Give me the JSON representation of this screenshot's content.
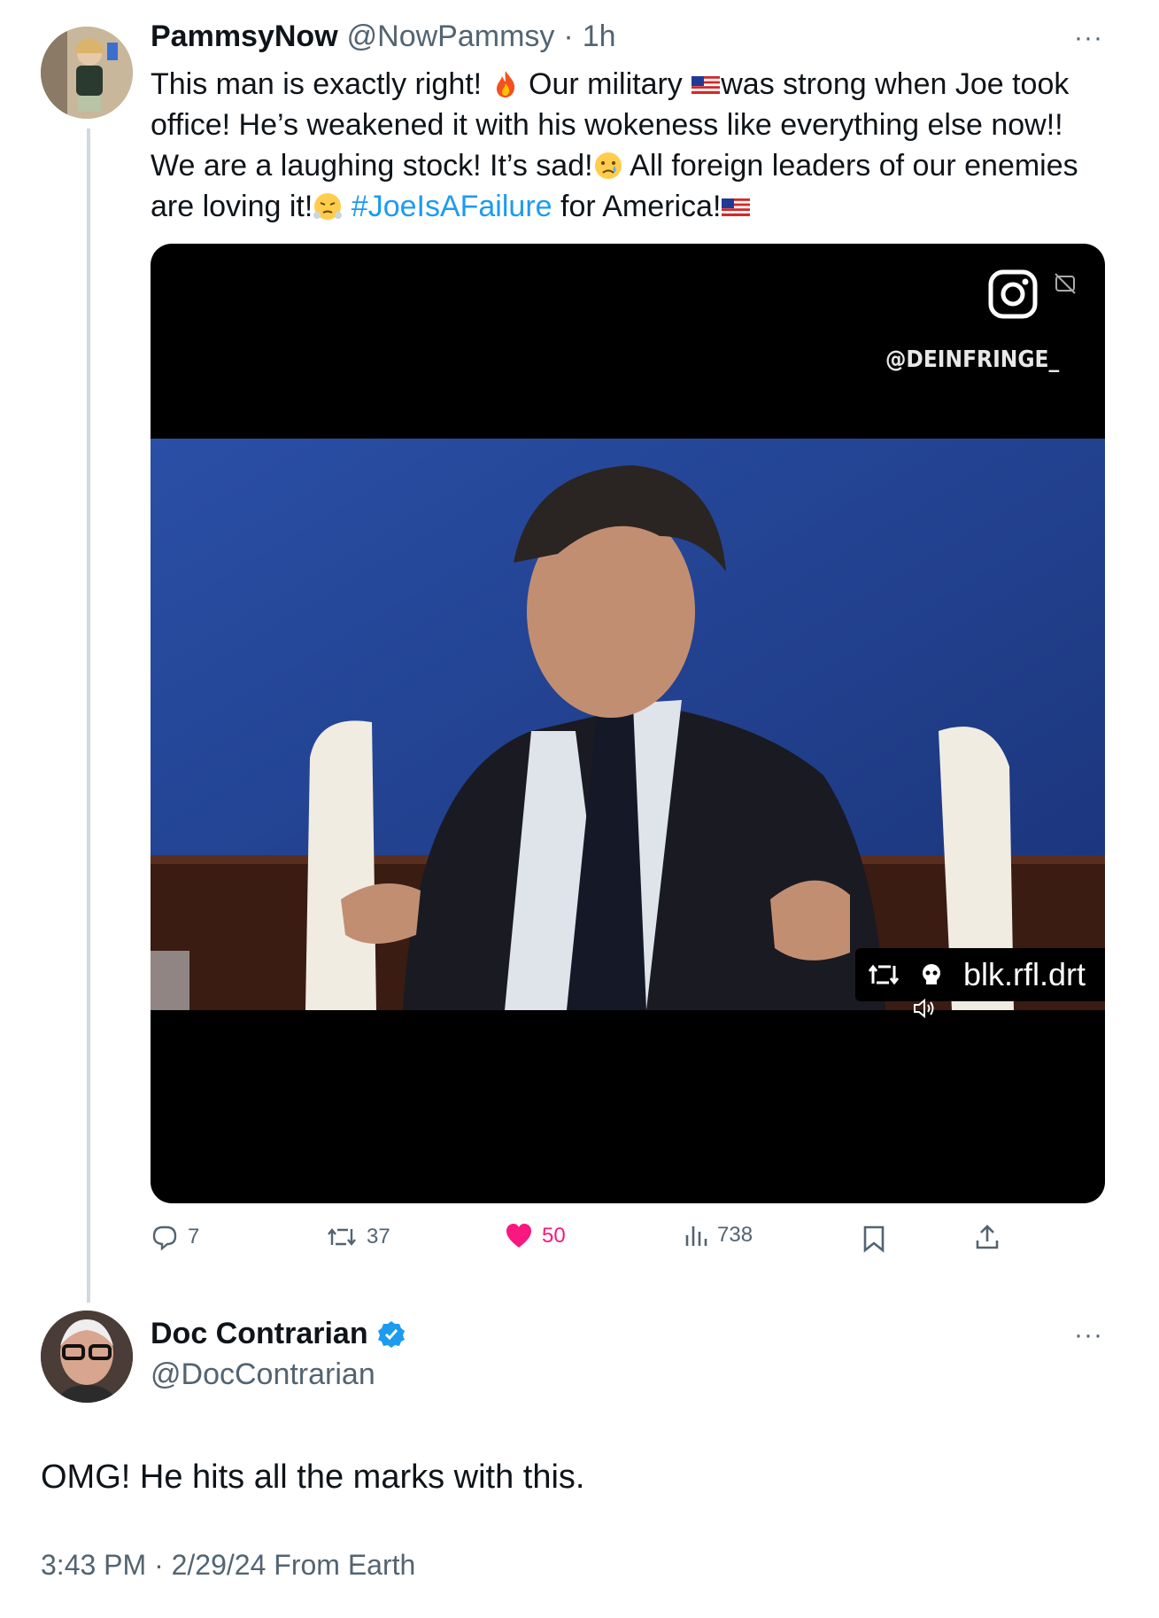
{
  "tweet1": {
    "display_name": "PammsyNow",
    "handle": "@NowPammsy",
    "separator": "·",
    "time": "1h",
    "more": "···",
    "text_1": "This man is exactly right! ",
    "text_2": " Our military ",
    "text_3": "was strong when Joe took office! He’s weakened it with his wokeness like everything else now!! We are a laughing stock! It’s sad!",
    "text_4": " All foreign leaders of our enemies are loving it!",
    "hashtag": "#JoeIsAFailure",
    "text_5": " for America!",
    "video": {
      "overlay_handle": "@DEINFRINGE_",
      "watermark_text": "blk.rfl.drt"
    },
    "actions": {
      "replies": "7",
      "reposts": "37",
      "likes": "50",
      "views": "738"
    }
  },
  "tweet2": {
    "display_name": "Doc Contrarian",
    "handle": "@DocContrarian",
    "more": "···",
    "text": "OMG! He hits all the marks with this.",
    "meta": "3:43 PM · 2/29/24 From Earth"
  },
  "colors": {
    "accent": "#1d9bf0",
    "like": "#f91880",
    "muted": "#536471",
    "thread_line": "#cfd9de"
  }
}
